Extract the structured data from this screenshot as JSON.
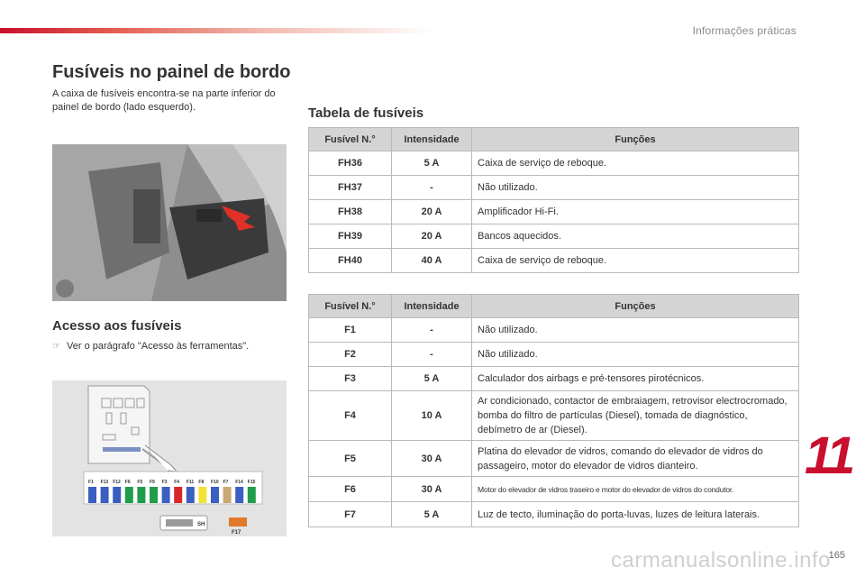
{
  "header": {
    "section": "Informações práticas"
  },
  "left": {
    "title": "Fusíveis no painel de bordo",
    "intro": "A caixa de fusíveis encontra-se na parte inferior do painel de bordo (lado esquerdo).",
    "access_title": "Acesso aos fusíveis",
    "access_bullet": "Ver o parágrafo \"Acesso às ferramentas\".",
    "diagram": {
      "top_labels": [
        "F1",
        "F13",
        "F12",
        "F6",
        "F5",
        "F9",
        "F3",
        "F4",
        "F11",
        "F8",
        "F10",
        "F7",
        "F14",
        "F15"
      ],
      "fuse_colors": [
        "#3b5fc0",
        "#3b5fc0",
        "#3b5fc0",
        "#1f9e4a",
        "#1f9e4a",
        "#1f9e4a",
        "#3b5fc0",
        "#d9262b",
        "#3b5fc0",
        "#f2e235",
        "#3b5fc0",
        "#c9a876",
        "#3b5fc0",
        "#1f9e4a"
      ],
      "sh_label": "SH",
      "f17_label": "F17"
    }
  },
  "table_title": "Tabela de fusíveis",
  "table_headers": {
    "num": "Fusível N.°",
    "amp": "Intensidade",
    "fn": "Funções"
  },
  "table1": [
    {
      "num": "FH36",
      "amp": "5 A",
      "fn": "Caixa de serviço de reboque."
    },
    {
      "num": "FH37",
      "amp": "-",
      "fn": "Não utilizado."
    },
    {
      "num": "FH38",
      "amp": "20 A",
      "fn": "Amplificador Hi-Fi."
    },
    {
      "num": "FH39",
      "amp": "20 A",
      "fn": "Bancos aquecidos."
    },
    {
      "num": "FH40",
      "amp": "40 A",
      "fn": "Caixa de serviço de reboque."
    }
  ],
  "table2": [
    {
      "num": "F1",
      "amp": "-",
      "fn": "Não utilizado."
    },
    {
      "num": "F2",
      "amp": "-",
      "fn": "Não utilizado."
    },
    {
      "num": "F3",
      "amp": "5 A",
      "fn": "Calculador dos airbags e pré-tensores pirotécnicos."
    },
    {
      "num": "F4",
      "amp": "10 A",
      "fn": "Ar condicionado, contactor de embraiagem, retrovisor electrocromado, bomba do filtro de partículas (Diesel), tomada de diagnóstico, debímetro de ar (Diesel)."
    },
    {
      "num": "F5",
      "amp": "30 A",
      "fn": "Platina do elevador de vidros, comando do elevador de vidros do passageiro, motor do elevador de vidros dianteiro."
    },
    {
      "num": "F6",
      "amp": "30 A",
      "fn": "Motor do elevador de vidros traseiro e motor do elevador de vidros do condutor."
    },
    {
      "num": "F7",
      "amp": "5 A",
      "fn": "Luz de tecto, iluminação do porta-luvas, luzes de leitura laterais."
    }
  ],
  "chapter": "11",
  "page_number": "165",
  "watermark": "carmanualsonline.info"
}
